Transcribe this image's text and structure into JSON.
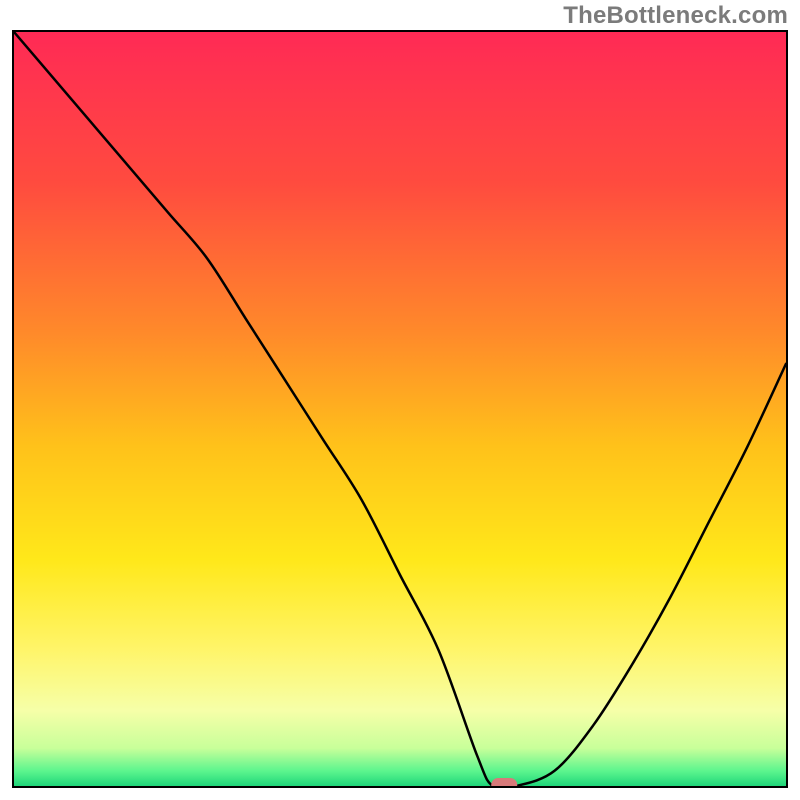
{
  "attribution": "TheBottleneck.com",
  "chart_data": {
    "type": "line",
    "title": "",
    "xlabel": "",
    "ylabel": "",
    "xlim": [
      0,
      100
    ],
    "ylim": [
      0,
      100
    ],
    "x": [
      0,
      5,
      10,
      15,
      20,
      25,
      30,
      35,
      40,
      45,
      50,
      55,
      60,
      62,
      65,
      70,
      75,
      80,
      85,
      90,
      95,
      100
    ],
    "values": [
      100,
      94,
      88,
      82,
      76,
      70,
      62,
      54,
      46,
      38,
      28,
      18,
      4,
      0,
      0,
      2,
      8,
      16,
      25,
      35,
      45,
      56
    ],
    "marker": {
      "x": 63.5,
      "y": 0,
      "color": "#d77a7a"
    },
    "gradient_stops": [
      {
        "offset": 0,
        "color": "#ff2a55"
      },
      {
        "offset": 20,
        "color": "#ff4b3f"
      },
      {
        "offset": 40,
        "color": "#ff8a2a"
      },
      {
        "offset": 55,
        "color": "#ffc21a"
      },
      {
        "offset": 70,
        "color": "#ffe81a"
      },
      {
        "offset": 82,
        "color": "#fff56a"
      },
      {
        "offset": 90,
        "color": "#f6ffa8"
      },
      {
        "offset": 95,
        "color": "#c8ff9a"
      },
      {
        "offset": 98,
        "color": "#5cf58e"
      },
      {
        "offset": 100,
        "color": "#1fd67a"
      }
    ]
  }
}
